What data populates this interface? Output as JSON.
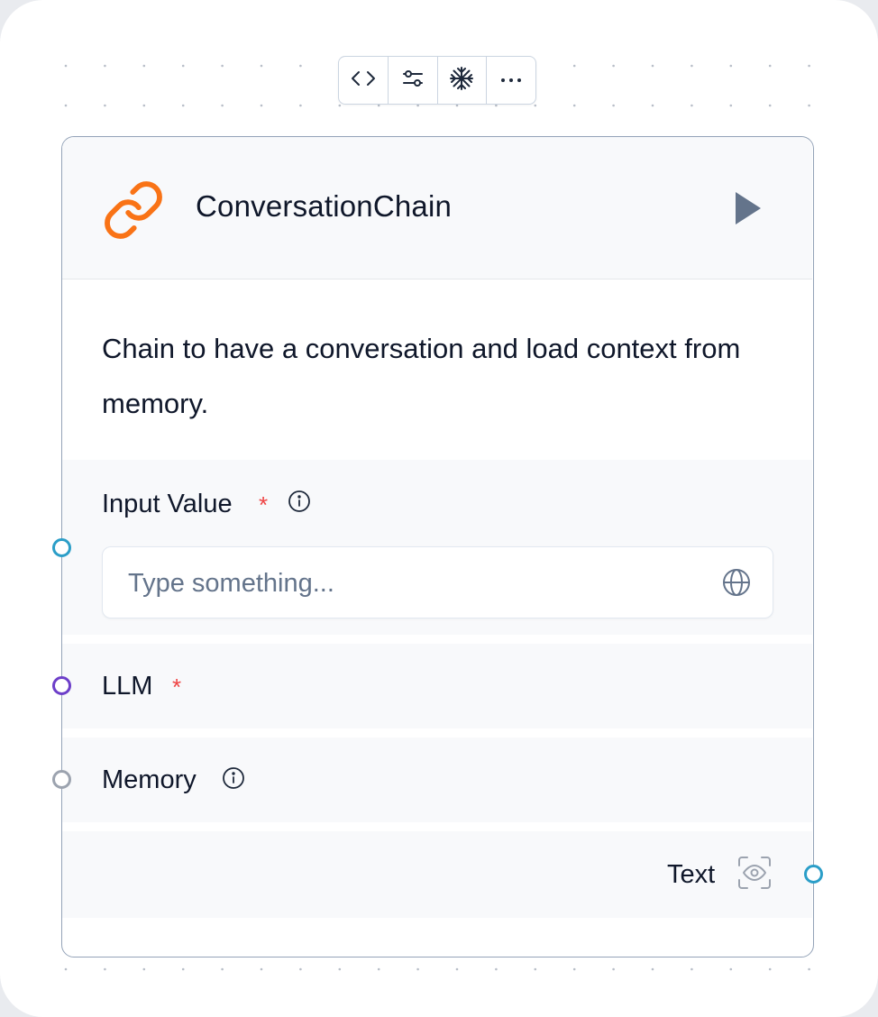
{
  "toolbar": {
    "buttons": [
      {
        "icon": "code-icon",
        "label": "Code"
      },
      {
        "icon": "sliders-icon",
        "label": "Advanced settings"
      },
      {
        "icon": "snowflake-icon",
        "label": "Freeze"
      },
      {
        "icon": "more-icon",
        "label": "More"
      }
    ]
  },
  "node": {
    "title": "ConversationChain",
    "icon": "chain-link-icon",
    "icon_color": "#f97316",
    "description": "Chain to have a conversation and load context from memory.",
    "fields": {
      "input_value": {
        "label": "Input Value",
        "required_mark": "*",
        "placeholder": "Type something...",
        "value": "",
        "handle_color": "#2b9ec8"
      },
      "llm": {
        "label": "LLM",
        "required_mark": "*",
        "handle_color": "#6d3fc9"
      },
      "memory": {
        "label": "Memory",
        "handle_color": "#9ca3af"
      }
    },
    "output": {
      "label": "Text",
      "handle_color": "#2b9ec8"
    }
  },
  "colors": {
    "required": "#ef4444",
    "border": "#94a3b8",
    "section_bg": "#f8f9fb"
  }
}
